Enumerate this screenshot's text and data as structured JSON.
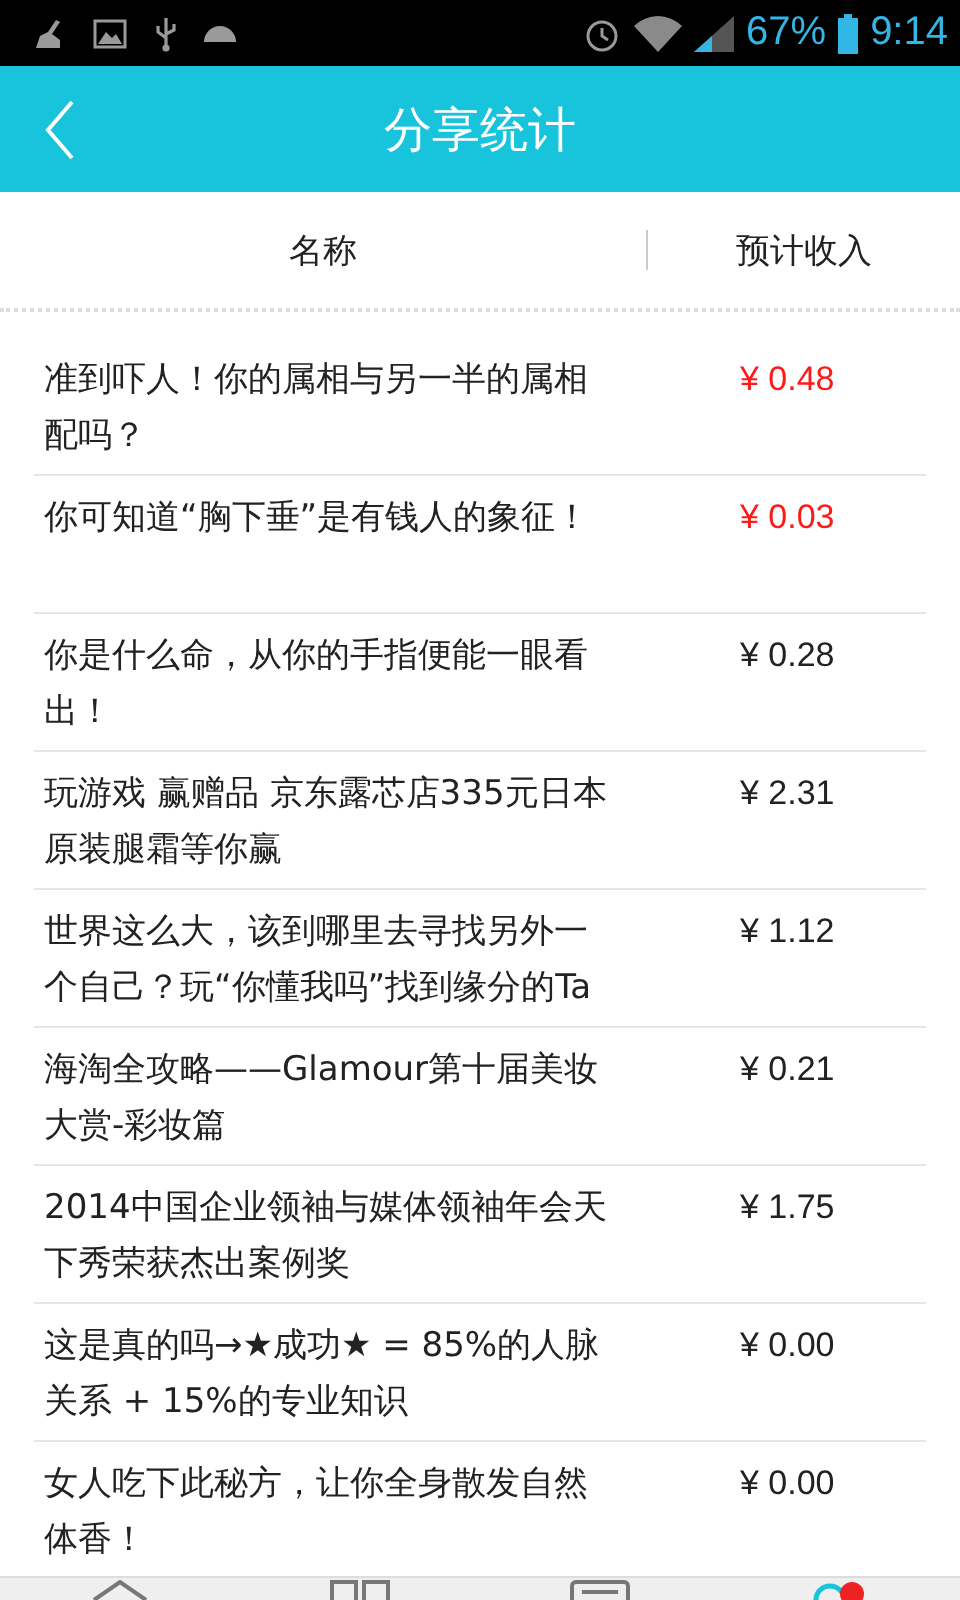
{
  "status_bar": {
    "battery": "67%",
    "time": "9:14"
  },
  "header": {
    "title": "分享统计"
  },
  "columns": [
    "名称",
    "预计收入"
  ],
  "rows": [
    {
      "name": "准到吓人！你的属相与另一半的属相配吗？",
      "income": "¥ 0.48",
      "highlighted": true
    },
    {
      "name": "你可知道“胸下垂”是有钱人的象征！",
      "income": "¥ 0.03",
      "highlighted": true
    },
    {
      "name": "你是什么命，从你的手指便能一眼看出！",
      "income": "¥ 0.28",
      "highlighted": false
    },
    {
      "name": "玩游戏 赢赠品 京东露芯店335元日本原装腿霜等你赢",
      "income": "¥ 2.31",
      "highlighted": false
    },
    {
      "name": "世界这么大，该到哪里去寻找另外一个自己？玩“你懂我吗”找到缘分的Ta",
      "income": "¥ 1.12",
      "highlighted": false
    },
    {
      "name": "海淘全攻略——Glamour第十届美妆大赏-彩妆篇",
      "income": "¥ 0.21",
      "highlighted": false
    },
    {
      "name": "2014中国企业领袖与媒体领袖年会天下秀荣获杰出案例奖",
      "income": "¥ 1.75",
      "highlighted": false
    },
    {
      "name": "这是真的吗→★成功★ = 85%的人脉关系 + 15%的专业知识",
      "income": "¥ 0.00",
      "highlighted": false
    },
    {
      "name": "女人吃下此秘方，让你全身散发自然体香！",
      "income": "¥ 0.00",
      "highlighted": false
    }
  ]
}
